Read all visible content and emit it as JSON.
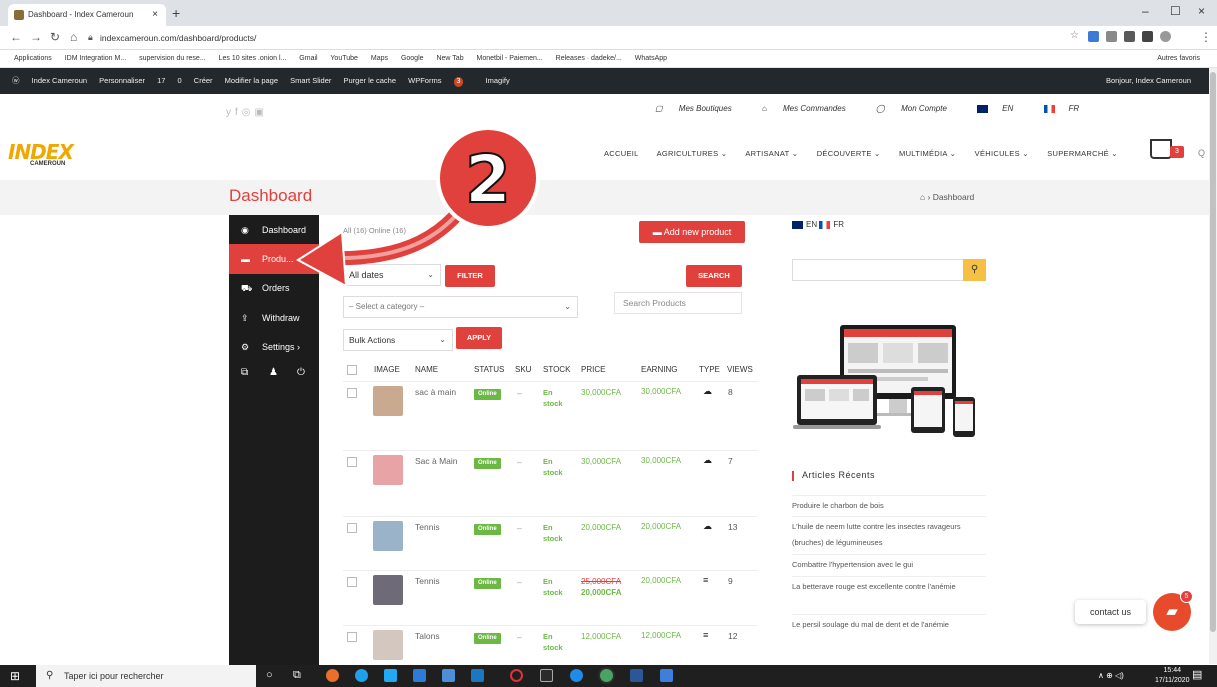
{
  "browser": {
    "tab_title": "Dashboard - Index Cameroun",
    "tab_close": "×",
    "new_tab": "+",
    "url": "indexcameroun.com/dashboard/products/",
    "window_controls": [
      "–",
      "☐",
      "×"
    ],
    "bookmarks": [
      "Applications",
      "IDM Integration M...",
      "supervision du rese...",
      "Les 10 sites .onion l...",
      "Gmail",
      "YouTube",
      "Maps",
      "Google",
      "New Tab",
      "Monetbil - Paiemen...",
      "Releases · dadeke/...",
      "WhatsApp"
    ],
    "bookmarks_right": "Autres favoris"
  },
  "wp_admin_bar": {
    "site": "Index Cameroun",
    "customize": "Personnaliser",
    "updates": "17",
    "comments": "0",
    "new": "Créer",
    "edit": "Modifier la page",
    "slider": "Smart Slider",
    "purge": "Purger le cache",
    "wpforms": "WPForms",
    "wpforms_badge": "3",
    "imagify": "Imagify",
    "greeting": "Bonjour, Index Cameroun"
  },
  "site_header": {
    "social_icons": [
      "twitter-icon",
      "facebook-icon",
      "instagram-icon",
      "youtube-icon"
    ],
    "top_links": [
      "Mes Boutiques",
      "Mes Commandes",
      "Mon Compte",
      "EN",
      "FR"
    ],
    "logo_text": "INDEX",
    "logo_sub": "CAMEROUN",
    "nav": [
      "ACCUEIL",
      "AGRICULTURES ⌄",
      "ARTISANAT ⌄",
      "DÉCOUVERTE ⌄",
      "MULTIMÉDIA ⌄",
      "VÉHICULES ⌄",
      "SUPERMARCHÉ ⌄"
    ],
    "cart_count": "3"
  },
  "page": {
    "title": "Dashboard",
    "breadcrumb": "⌂ › Dashboard"
  },
  "sidebar": {
    "items": [
      {
        "icon": "dashboard-icon",
        "label": "Dashboard"
      },
      {
        "icon": "briefcase-icon",
        "label": "Produ..."
      },
      {
        "icon": "cart-icon",
        "label": "Orders"
      },
      {
        "icon": "upload-icon",
        "label": "Withdraw"
      },
      {
        "icon": "gear-icon",
        "label": "Settings ›"
      }
    ]
  },
  "products": {
    "tabs": "All (16)   Online (16)",
    "add_button": "Add new product",
    "date_filter": "All dates",
    "filter_button": "FILTER",
    "search_button": "SEARCH",
    "category_select": "– Select a category –",
    "search_placeholder": "Search Products",
    "bulk_select": "Bulk Actions",
    "apply_button": "APPLY",
    "columns": [
      "IMAGE",
      "NAME",
      "STATUS",
      "SKU",
      "STOCK",
      "PRICE",
      "EARNING",
      "TYPE",
      "VIEWS"
    ],
    "rows": [
      {
        "name": "sac à main",
        "status": "Online",
        "sku": "–",
        "stock": "En stock",
        "price": "30,000CFA",
        "price_old": "",
        "earning": "30,000CFA",
        "type": "☁",
        "views": "8",
        "img_color": "#c9a98f"
      },
      {
        "name": "Sac à Main",
        "status": "Online",
        "sku": "–",
        "stock": "En stock",
        "price": "30,000CFA",
        "price_old": "",
        "earning": "30,000CFA",
        "type": "☁",
        "views": "7",
        "img_color": "#e7a3a6"
      },
      {
        "name": "Tennis",
        "status": "Online",
        "sku": "–",
        "stock": "En stock",
        "price": "20,000CFA",
        "price_old": "",
        "earning": "20,000CFA",
        "type": "☁",
        "views": "13",
        "img_color": "#9bb3c9"
      },
      {
        "name": "Tennis",
        "status": "Online",
        "sku": "–",
        "stock": "En stock",
        "price": "20,000CFA",
        "price_old": "25,000CFA",
        "earning": "20,000CFA",
        "type": "≡",
        "views": "9",
        "img_color": "#6f6a78"
      },
      {
        "name": "Talons",
        "status": "Online",
        "sku": "–",
        "stock": "En stock",
        "price": "12,000CFA",
        "price_old": "",
        "earning": "12,000CFA",
        "type": "≡",
        "views": "12",
        "img_color": "#d3c7c0"
      }
    ]
  },
  "right_sidebar": {
    "lang_en": "EN",
    "lang_fr": "FR",
    "recent_title": "Articles Récents",
    "recent": [
      "Produire le charbon de bois",
      "L'huile de neem lutte contre les insectes ravageurs (bruches) de légumineuses",
      "Combattre l'hypertension avec le gui",
      "La betterave rouge est excellente contre l'anémie",
      "Le persil soulage du mal de dent et de l'anémie"
    ]
  },
  "chat": {
    "contact_label": "contact us",
    "badge": "5"
  },
  "annotation": {
    "number": "2"
  },
  "taskbar": {
    "search_placeholder": "Taper ici pour rechercher",
    "time": "15:44",
    "date": "17/11/2020",
    "tray": "∧ ⊕ ◁)"
  },
  "colors": {
    "accent": "#e0413c",
    "online": "#6cb845",
    "sidebar": "#1c1c1c",
    "wpbar": "#23282d"
  }
}
